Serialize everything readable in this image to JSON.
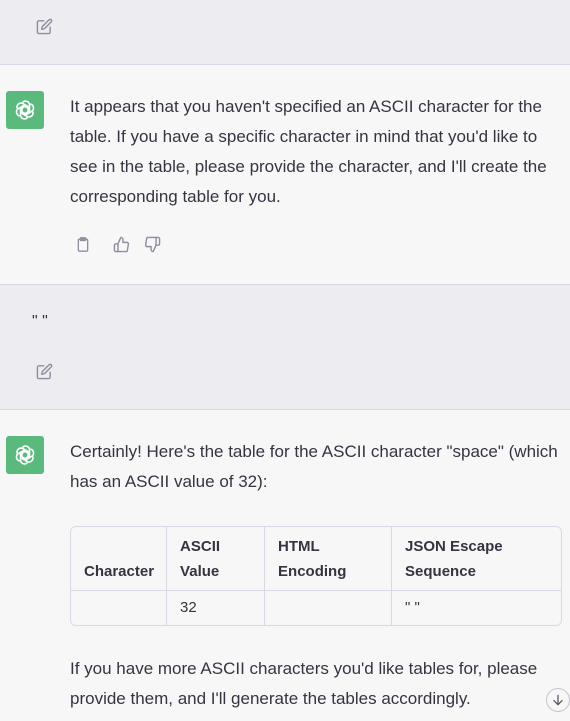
{
  "messages": [
    {
      "role": "user",
      "text": ""
    },
    {
      "role": "assistant",
      "text": "It appears that you haven't specified an ASCII character for the table. If you have a specific character in mind that you'd like to see in the table, please provide the character, and I'll create the corresponding table for you."
    },
    {
      "role": "user",
      "text": "\" \""
    },
    {
      "role": "assistant",
      "intro": "Certainly! Here's the table for the ASCII character \"space\" (which has an ASCII value of 32):",
      "table": {
        "headers": [
          "Character",
          "ASCII Value",
          "HTML Encoding",
          "JSON Escape Sequence"
        ],
        "rows": [
          [
            "",
            "32",
            "",
            "\" \""
          ]
        ]
      },
      "outro": "If you have more ASCII characters you'd like tables for, please provide them, and I'll generate the tables accordingly."
    }
  ],
  "colors": {
    "avatar_bg": "#5aba7e",
    "user_bg": "#ececf1",
    "assistant_bg": "#f7f7f8",
    "icon": "#8e8ea0"
  },
  "icons": {
    "edit": "edit-icon",
    "copy": "clipboard-icon",
    "like": "thumbs-up-icon",
    "dislike": "thumbs-down-icon",
    "avatar": "chatgpt-logo-icon",
    "scroll": "arrow-down-icon"
  }
}
